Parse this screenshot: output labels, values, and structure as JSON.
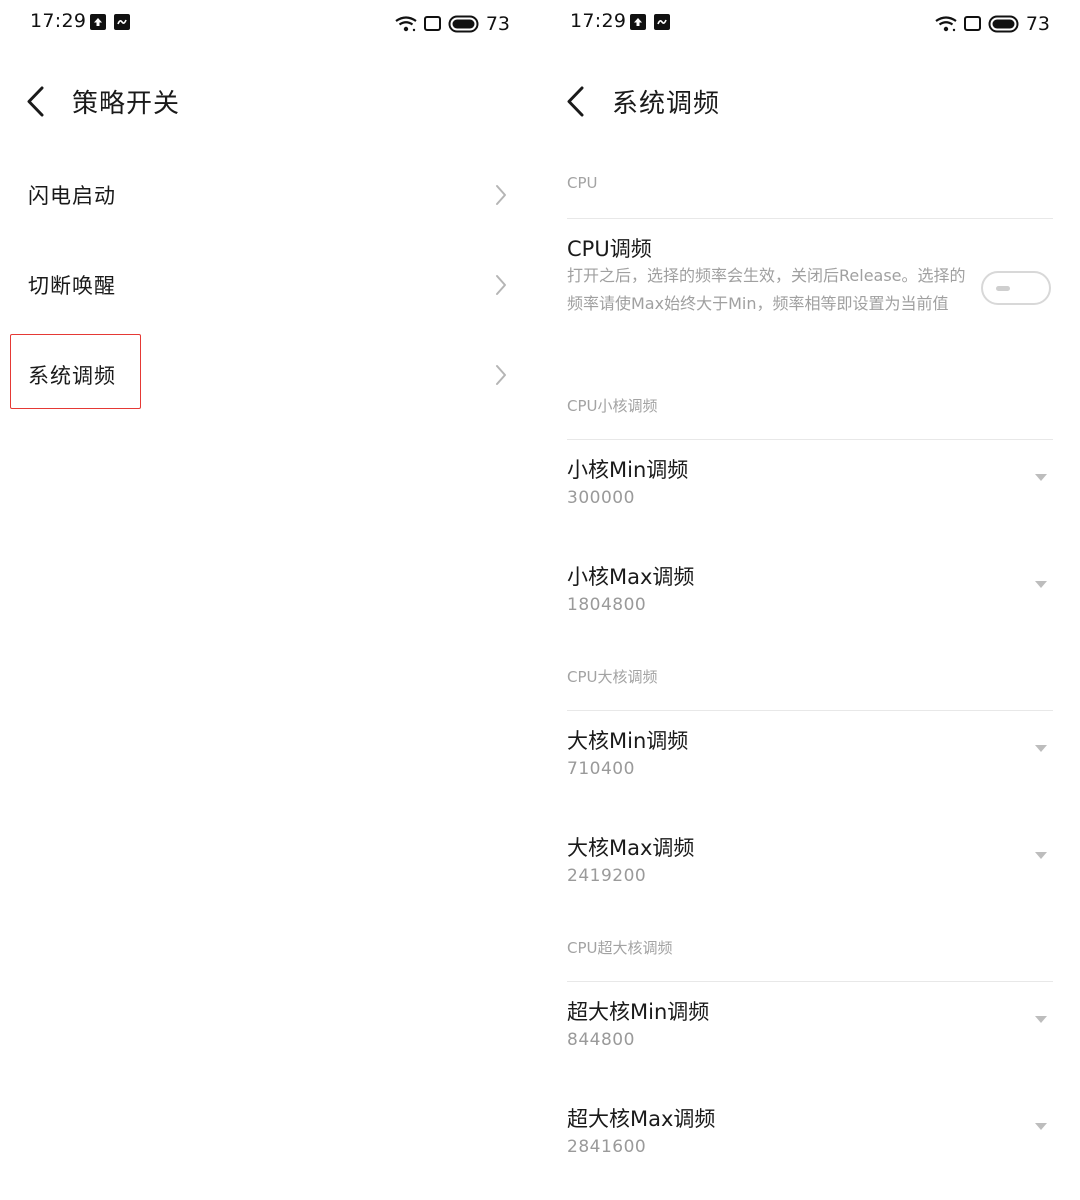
{
  "status_bar": {
    "time": "17:29",
    "battery": "73"
  },
  "left_screen": {
    "title": "策略开关",
    "items": [
      {
        "label": "闪电启动"
      },
      {
        "label": "切断唤醒"
      },
      {
        "label": "系统调频"
      }
    ]
  },
  "right_screen": {
    "title": "系统调频",
    "sections": {
      "cpu": {
        "header": "CPU",
        "toggle_title": "CPU调频",
        "toggle_desc": "打开之后，选择的频率会生效，关闭后Release。选择的频率请使Max始终大于Min，频率相等即设置为当前值",
        "toggle_on": false
      },
      "small": {
        "header": "CPU小核调频",
        "min": {
          "title": "小核Min调频",
          "value": "300000"
        },
        "max": {
          "title": "小核Max调频",
          "value": "1804800"
        }
      },
      "big": {
        "header": "CPU大核调频",
        "min": {
          "title": "大核Min调频",
          "value": "710400"
        },
        "max": {
          "title": "大核Max调频",
          "value": "2419200"
        }
      },
      "prime": {
        "header": "CPU超大核调频",
        "min": {
          "title": "超大核Min调频",
          "value": "844800"
        },
        "max": {
          "title": "超大核Max调频",
          "value": "2841600"
        }
      }
    }
  },
  "colors": {
    "highlight": "#e53935",
    "secondary_text": "#a0a0a0",
    "divider": "#e8e8e8"
  }
}
